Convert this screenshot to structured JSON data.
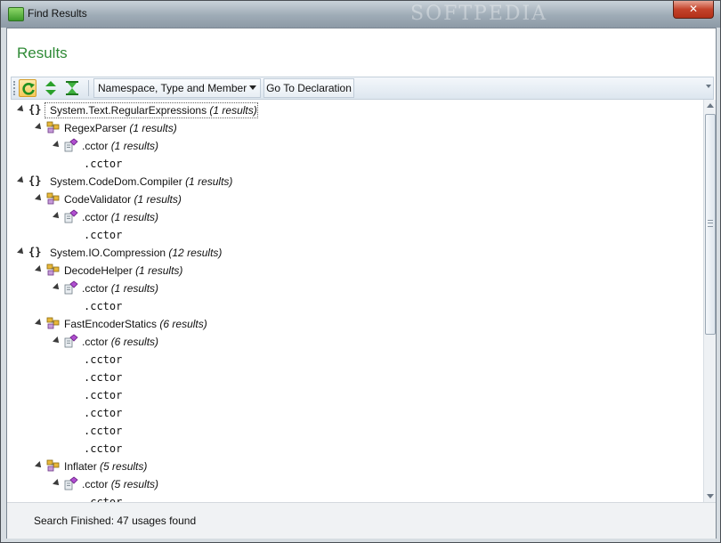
{
  "window": {
    "title": "Find Results",
    "watermark": "SOFTPEDIA",
    "close_label": "✕"
  },
  "header": {
    "title": "Results"
  },
  "toolbar": {
    "buttons": [
      {
        "name": "refresh-icon",
        "active": true
      },
      {
        "name": "expand-collapse-icon",
        "active": false
      },
      {
        "name": "hourglass-icon",
        "active": false
      }
    ],
    "group_by_value": "Namespace, Type and Member",
    "goto_label": "Go To Declaration"
  },
  "tree": [
    {
      "kind": "ns",
      "label": "System.Text.RegularExpressions",
      "count": "(1 results)",
      "focused": true
    },
    {
      "kind": "class",
      "label": "RegexParser",
      "count": "(1 results)"
    },
    {
      "kind": "method",
      "label": ".cctor",
      "count": "(1 results)"
    },
    {
      "kind": "leaf",
      "label": ".cctor"
    },
    {
      "kind": "ns",
      "label": "System.CodeDom.Compiler",
      "count": "(1 results)"
    },
    {
      "kind": "class",
      "label": "CodeValidator",
      "count": "(1 results)"
    },
    {
      "kind": "method",
      "label": ".cctor",
      "count": "(1 results)"
    },
    {
      "kind": "leaf",
      "label": ".cctor"
    },
    {
      "kind": "ns",
      "label": "System.IO.Compression",
      "count": "(12 results)"
    },
    {
      "kind": "class",
      "label": "DecodeHelper",
      "count": "(1 results)"
    },
    {
      "kind": "method",
      "label": ".cctor",
      "count": "(1 results)"
    },
    {
      "kind": "leaf",
      "label": ".cctor"
    },
    {
      "kind": "class",
      "label": "FastEncoderStatics",
      "count": "(6 results)"
    },
    {
      "kind": "method",
      "label": ".cctor",
      "count": "(6 results)"
    },
    {
      "kind": "leaf",
      "label": ".cctor"
    },
    {
      "kind": "leaf",
      "label": ".cctor"
    },
    {
      "kind": "leaf",
      "label": ".cctor"
    },
    {
      "kind": "leaf",
      "label": ".cctor"
    },
    {
      "kind": "leaf",
      "label": ".cctor"
    },
    {
      "kind": "leaf",
      "label": ".cctor"
    },
    {
      "kind": "class",
      "label": "Inflater",
      "count": "(5 results)"
    },
    {
      "kind": "method",
      "label": ".cctor",
      "count": "(5 results)"
    },
    {
      "kind": "leaf",
      "label": ".cctor"
    }
  ],
  "status": {
    "text": "Search Finished:  47 usages found"
  },
  "colors": {
    "accent_green": "#2f8a36",
    "method_purple": "#b04fd0",
    "class_gold": "#d9a520"
  }
}
